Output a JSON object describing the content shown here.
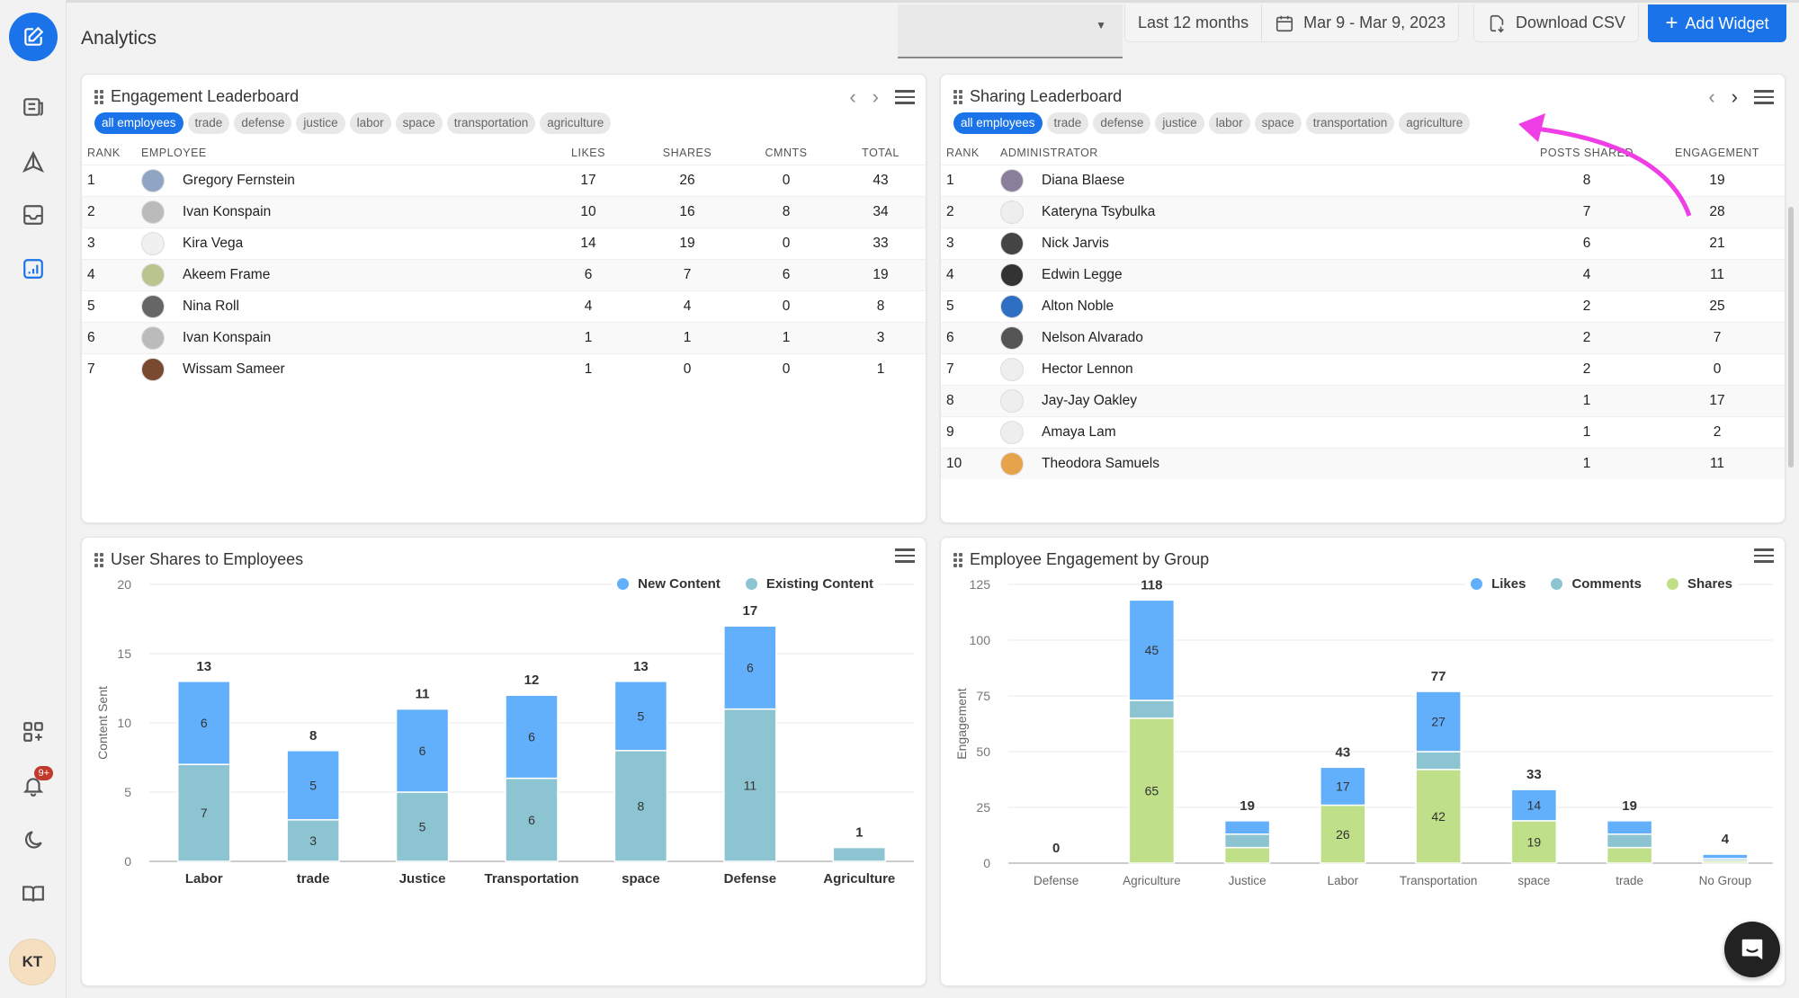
{
  "header": {
    "title": "Analytics",
    "range_label": "Last 12 months",
    "date_range": "Mar 9 - Mar 9, 2023",
    "download_label": "Download CSV",
    "add_widget_label": "Add Widget"
  },
  "sidebar": {
    "items": [
      {
        "icon": "compose-icon",
        "label": "Compose"
      },
      {
        "icon": "newspaper-icon",
        "label": "Content"
      },
      {
        "icon": "send-icon",
        "label": "Share"
      },
      {
        "icon": "inbox-icon",
        "label": "Inbox"
      },
      {
        "icon": "analytics-icon",
        "label": "Analytics",
        "active": true
      },
      {
        "icon": "add-widget-grid-icon",
        "label": "Apps"
      },
      {
        "icon": "bell-icon",
        "label": "Notifications",
        "badge": "9+"
      },
      {
        "icon": "moon-icon",
        "label": "Dark mode"
      },
      {
        "icon": "book-icon",
        "label": "Docs"
      }
    ],
    "user_initials": "KT"
  },
  "filters": [
    "all employees",
    "trade",
    "defense",
    "justice",
    "labor",
    "space",
    "transportation",
    "agriculture"
  ],
  "engagement_leaderboard": {
    "title": "Engagement Leaderboard",
    "columns": [
      "RANK",
      "EMPLOYEE",
      "LIKES",
      "SHARES",
      "CMNTS",
      "TOTAL"
    ],
    "rows": [
      {
        "rank": "1",
        "name": "Gregory Fernstein",
        "likes": "17",
        "shares": "26",
        "cmnts": "0",
        "total": "43"
      },
      {
        "rank": "2",
        "name": "Ivan Konspain",
        "likes": "10",
        "shares": "16",
        "cmnts": "8",
        "total": "34"
      },
      {
        "rank": "3",
        "name": "Kira Vega",
        "likes": "14",
        "shares": "19",
        "cmnts": "0",
        "total": "33"
      },
      {
        "rank": "4",
        "name": "Akeem Frame",
        "likes": "6",
        "shares": "7",
        "cmnts": "6",
        "total": "19"
      },
      {
        "rank": "5",
        "name": "Nina Roll",
        "likes": "4",
        "shares": "4",
        "cmnts": "0",
        "total": "8"
      },
      {
        "rank": "6",
        "name": "Ivan Konspain",
        "likes": "1",
        "shares": "1",
        "cmnts": "1",
        "total": "3"
      },
      {
        "rank": "7",
        "name": "Wissam Sameer",
        "likes": "1",
        "shares": "0",
        "cmnts": "0",
        "total": "1"
      }
    ]
  },
  "sharing_leaderboard": {
    "title": "Sharing Leaderboard",
    "columns": [
      "RANK",
      "ADMINISTRATOR",
      "POSTS SHARED",
      "ENGAGEMENT"
    ],
    "rows": [
      {
        "rank": "1",
        "name": "Diana Blaese",
        "posts": "8",
        "engagement": "19"
      },
      {
        "rank": "2",
        "name": "Kateryna Tsybulka",
        "posts": "7",
        "engagement": "28"
      },
      {
        "rank": "3",
        "name": "Nick Jarvis",
        "posts": "6",
        "engagement": "21"
      },
      {
        "rank": "4",
        "name": "Edwin Legge",
        "posts": "4",
        "engagement": "11"
      },
      {
        "rank": "5",
        "name": "Alton Noble",
        "posts": "2",
        "engagement": "25"
      },
      {
        "rank": "6",
        "name": "Nelson Alvarado",
        "posts": "2",
        "engagement": "7"
      },
      {
        "rank": "7",
        "name": "Hector Lennon",
        "posts": "2",
        "engagement": "0"
      },
      {
        "rank": "8",
        "name": "Jay-Jay Oakley",
        "posts": "1",
        "engagement": "17"
      },
      {
        "rank": "9",
        "name": "Amaya Lam",
        "posts": "1",
        "engagement": "2"
      },
      {
        "rank": "10",
        "name": "Theodora Samuels",
        "posts": "1",
        "engagement": "11"
      }
    ]
  },
  "colors": {
    "accent": "#1a73e8",
    "new_content": "#62b0fc",
    "existing_content": "#8cc5d1",
    "likes": "#62b0fc",
    "comments": "#8cc5d1",
    "shares": "#bfdf88"
  },
  "chart_data": [
    {
      "type": "bar",
      "stacked": true,
      "title": "User Shares to Employees",
      "xlabel": "",
      "ylabel": "Content Sent",
      "ylim": [
        0,
        20
      ],
      "yticks": [
        0,
        5,
        10,
        15,
        20
      ],
      "grid": true,
      "legend": "top-right",
      "categories": [
        "Labor",
        "trade",
        "Justice",
        "Transportation",
        "space",
        "Defense",
        "Agriculture"
      ],
      "series": [
        {
          "name": "Existing Content",
          "values": [
            7,
            3,
            5,
            6,
            8,
            11,
            1
          ]
        },
        {
          "name": "New Content",
          "values": [
            6,
            5,
            6,
            6,
            5,
            6,
            0
          ]
        }
      ],
      "totals": [
        13,
        8,
        11,
        12,
        13,
        17,
        1
      ]
    },
    {
      "type": "bar",
      "stacked": true,
      "title": "Employee Engagement by Group",
      "xlabel": "",
      "ylabel": "Engagement",
      "ylim": [
        0,
        125
      ],
      "yticks": [
        0,
        25,
        50,
        75,
        100,
        125
      ],
      "grid": true,
      "legend": "top-right",
      "categories": [
        "Defense",
        "Agriculture",
        "Justice",
        "Labor",
        "Transportation",
        "space",
        "trade",
        "No Group"
      ],
      "series": [
        {
          "name": "Shares",
          "values": [
            0,
            65,
            7,
            26,
            42,
            19,
            7,
            1
          ]
        },
        {
          "name": "Comments",
          "values": [
            0,
            8,
            6,
            0,
            8,
            0,
            6,
            1
          ]
        },
        {
          "name": "Likes",
          "values": [
            0,
            45,
            6,
            17,
            27,
            14,
            6,
            2
          ]
        }
      ],
      "totals": [
        0,
        118,
        19,
        43,
        77,
        33,
        19,
        4
      ]
    }
  ]
}
